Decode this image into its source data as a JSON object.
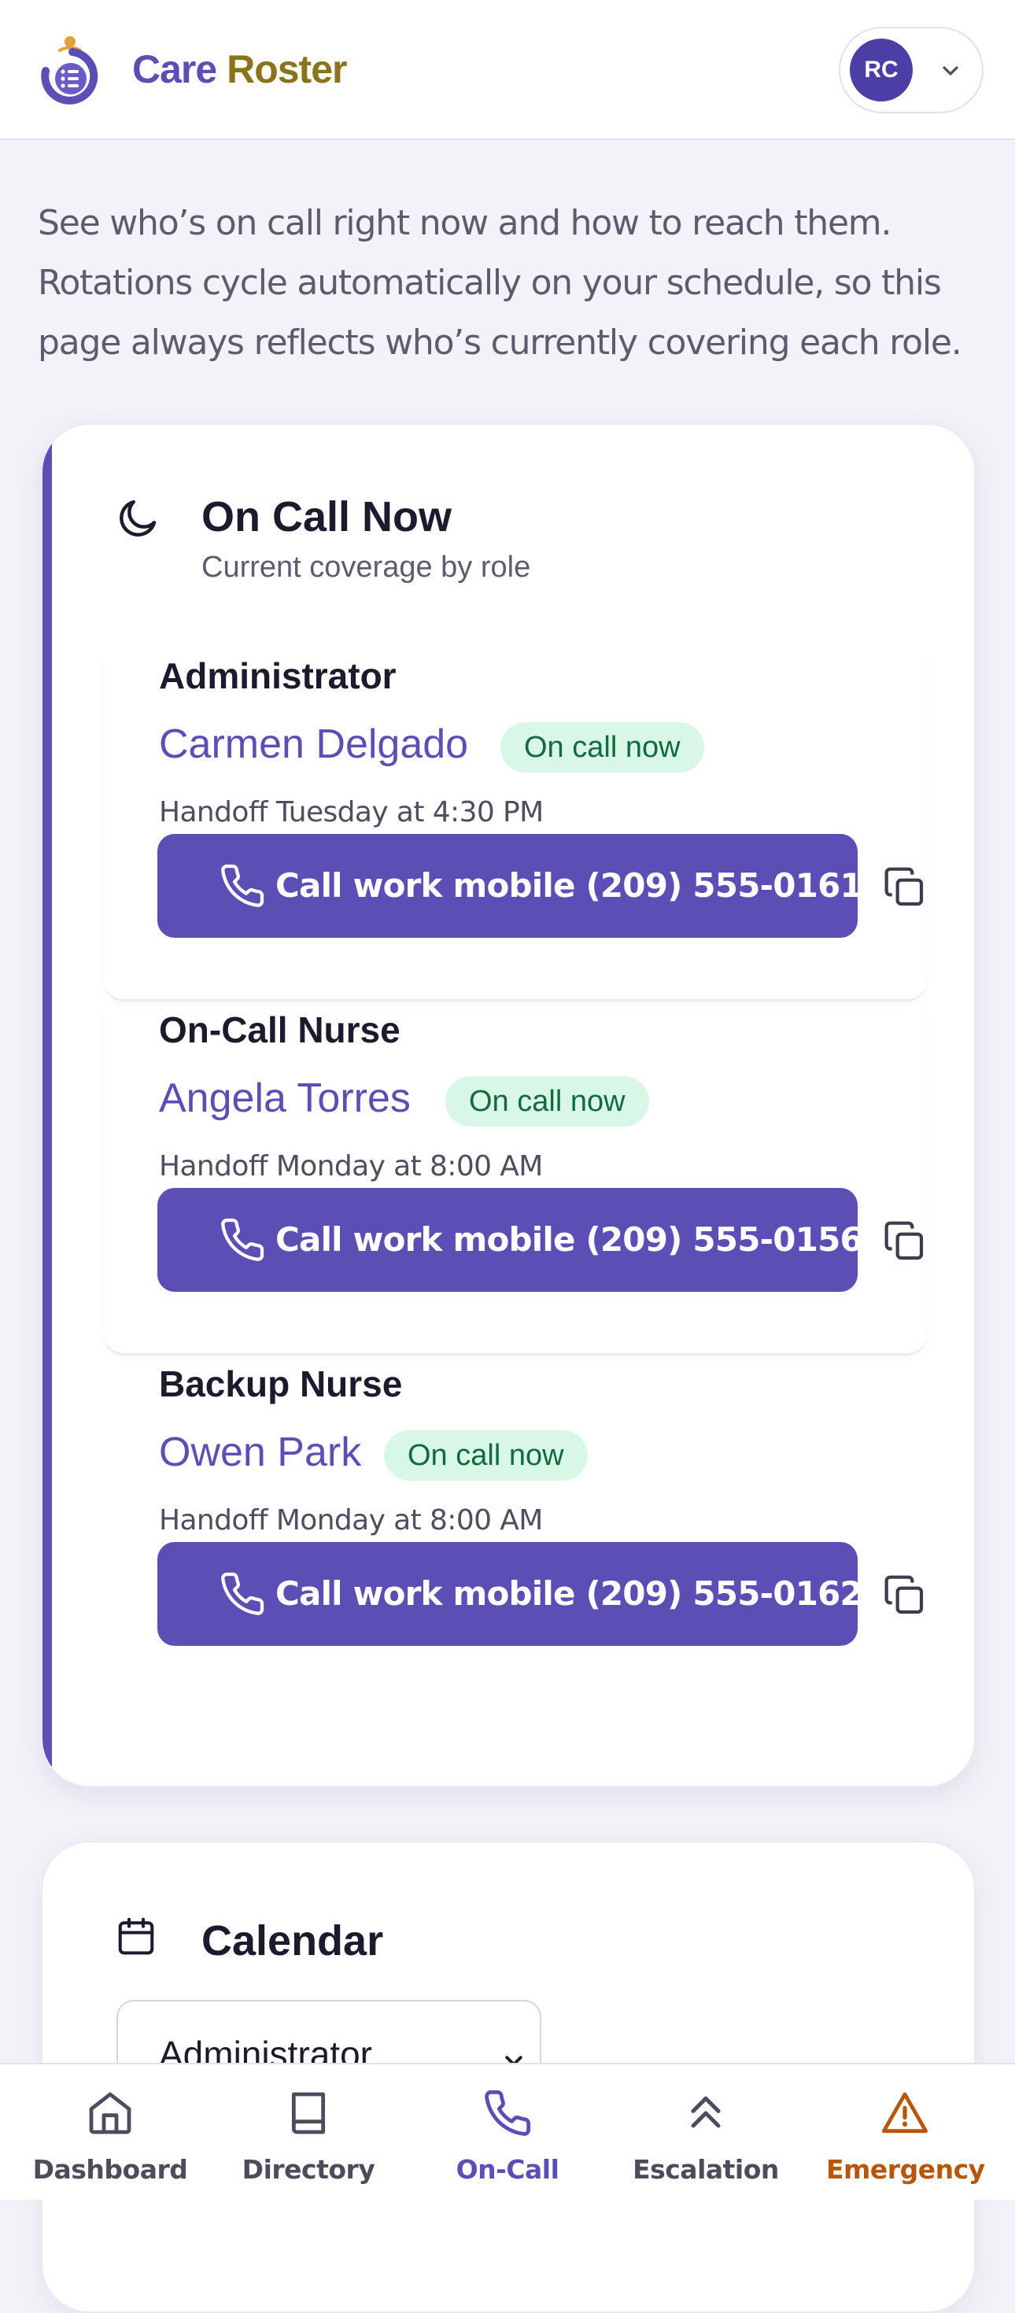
{
  "header": {
    "brand_part1": "Care",
    "brand_part2": "Roster",
    "avatar_initials": "RC"
  },
  "intro": "See who’s on call right now and how to reach them. Rotations cycle automatically on your schedule, so this page always reflects who’s currently covering each role.",
  "on_call": {
    "title": "On Call Now",
    "subtitle": "Current coverage by role",
    "roles": [
      {
        "role": "Administrator",
        "person": "Carmen Delgado",
        "badge": "On call now",
        "handoff": "Handoff Tuesday at 4:30 PM",
        "call_label": "Call work mobile (209) 555-0161"
      },
      {
        "role": "On-Call Nurse",
        "person": "Angela Torres",
        "badge": "On call now",
        "handoff": "Handoff Monday at 8:00 AM",
        "call_label": "Call work mobile (209) 555-0156"
      },
      {
        "role": "Backup Nurse",
        "person": "Owen Park",
        "badge": "On call now",
        "handoff": "Handoff Monday at 8:00 AM",
        "call_label": "Call work mobile (209) 555-0162"
      }
    ]
  },
  "calendar": {
    "title": "Calendar",
    "selected_role": "Administrator"
  },
  "nav": {
    "items": [
      {
        "label": "Dashboard",
        "icon": "home-icon"
      },
      {
        "label": "Directory",
        "icon": "book-icon"
      },
      {
        "label": "On-Call",
        "icon": "phone-icon"
      },
      {
        "label": "Escalation",
        "icon": "chevrons-up-icon"
      },
      {
        "label": "Emergency",
        "icon": "warning-icon"
      }
    ],
    "active": "On-Call"
  },
  "colors": {
    "primary": "#5b4fb5",
    "brand_gold": "#8a7318",
    "badge_bg": "#d8f7e6",
    "badge_text": "#126a3f",
    "emergency": "#b8570c"
  }
}
